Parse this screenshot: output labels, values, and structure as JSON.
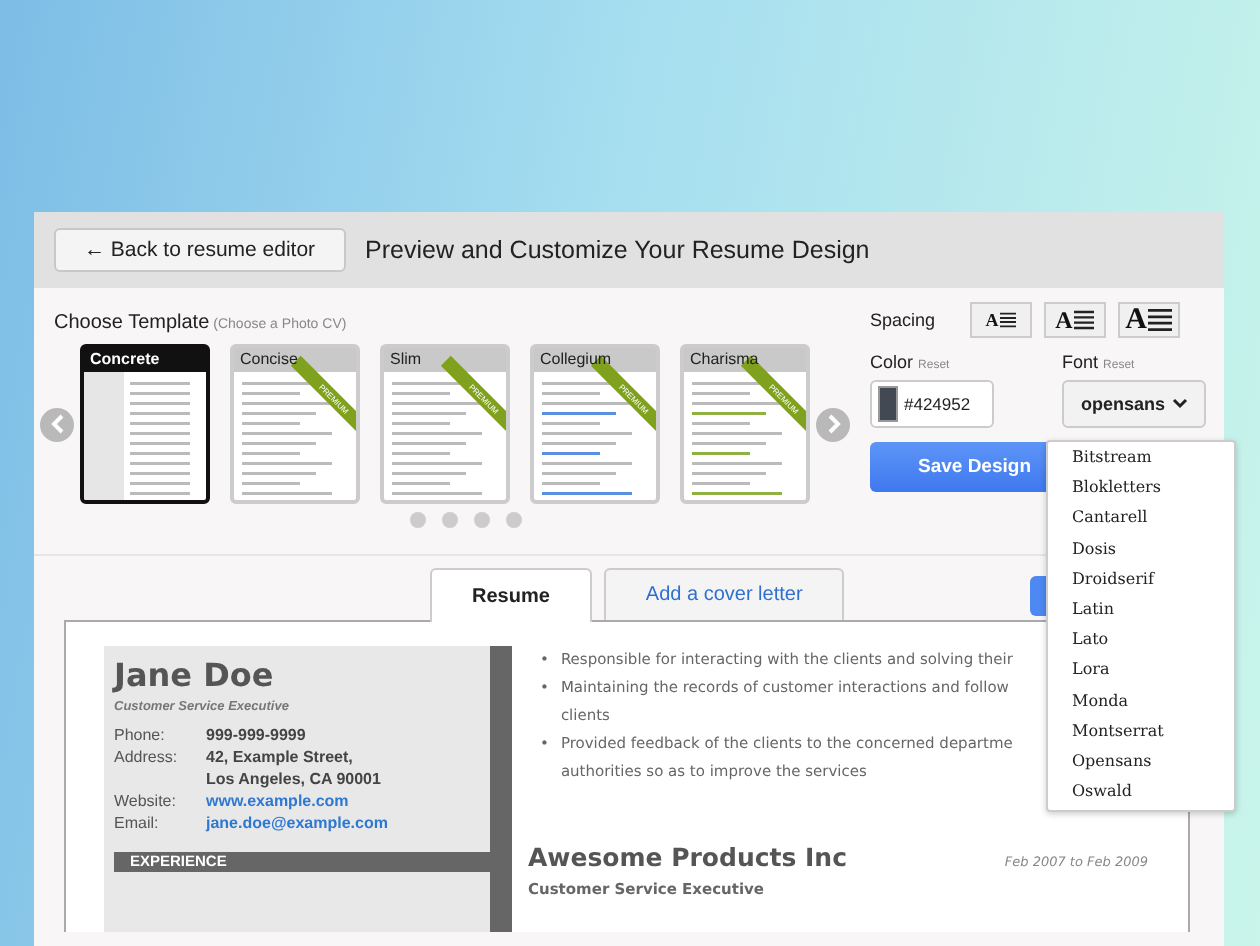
{
  "header": {
    "back_button": "← Back to resume editor",
    "title": "Preview and Customize Your Resume Design"
  },
  "templates": {
    "label": "Choose Template",
    "hint": "(Choose a Photo CV)",
    "items": [
      {
        "name": "Concrete",
        "selected": true
      },
      {
        "name": "Concise",
        "selected": false,
        "ribbon": "PREMIUM"
      },
      {
        "name": "Slim",
        "selected": false,
        "ribbon": "PREMIUM"
      },
      {
        "name": "Collegium",
        "selected": false,
        "ribbon": "PREMIUM"
      },
      {
        "name": "Charisma",
        "selected": false,
        "ribbon": "PREMIUM"
      }
    ],
    "pager": [
      {
        "selected": false
      },
      {
        "selected": false
      },
      {
        "selected": false
      },
      {
        "selected": false
      }
    ]
  },
  "spacing": {
    "label": "Spacing",
    "options": [
      {
        "glyph": "A",
        "selected": false
      },
      {
        "glyph": "A",
        "selected": false
      },
      {
        "glyph": "A",
        "selected": false
      }
    ]
  },
  "color": {
    "label": "Color",
    "reset": "Reset",
    "value": "#424952"
  },
  "font": {
    "label": "Font",
    "reset": "Reset",
    "value": "opensans",
    "options": [
      "Bitstream",
      "Blokletters",
      "Cantarell",
      "Dosis",
      "Droidserif",
      "Latin",
      "Lato",
      "Lora",
      "Monda",
      "Montserrat",
      "Opensans",
      "Oswald"
    ]
  },
  "save_button": "Save Design",
  "tabs": [
    {
      "label": "Resume",
      "selected": true
    },
    {
      "label": "Add a cover letter",
      "selected": false
    }
  ],
  "resume": {
    "name": "Jane Doe",
    "title": "Customer Service Executive",
    "contacts": [
      {
        "label": "Phone:",
        "lines": [
          "999-999-9999"
        ],
        "link": false
      },
      {
        "label": "Address:",
        "lines": [
          "42, Example Street,",
          "Los Angeles, CA 90001"
        ],
        "link": false
      },
      {
        "label": "Website:",
        "lines": [
          "www.example.com"
        ],
        "link": true
      },
      {
        "label": "Email:",
        "lines": [
          "jane.doe@example.com"
        ],
        "link": true
      }
    ],
    "section": "EXPERIENCE",
    "bullets": [
      {
        "mark": "•",
        "lines": [
          "Responsible for interacting with the clients and solving their"
        ]
      },
      {
        "mark": "•",
        "lines": [
          "Maintaining the records of customer interactions and follow",
          "clients"
        ]
      },
      {
        "mark": "•",
        "lines": [
          "Provided feedback of the clients to the concerned departme",
          "authorities so as to improve the services"
        ]
      }
    ],
    "company": "Awesome Products Inc",
    "dates": "Feb 2007 to Feb 2009",
    "role": "Customer Service Executive"
  }
}
